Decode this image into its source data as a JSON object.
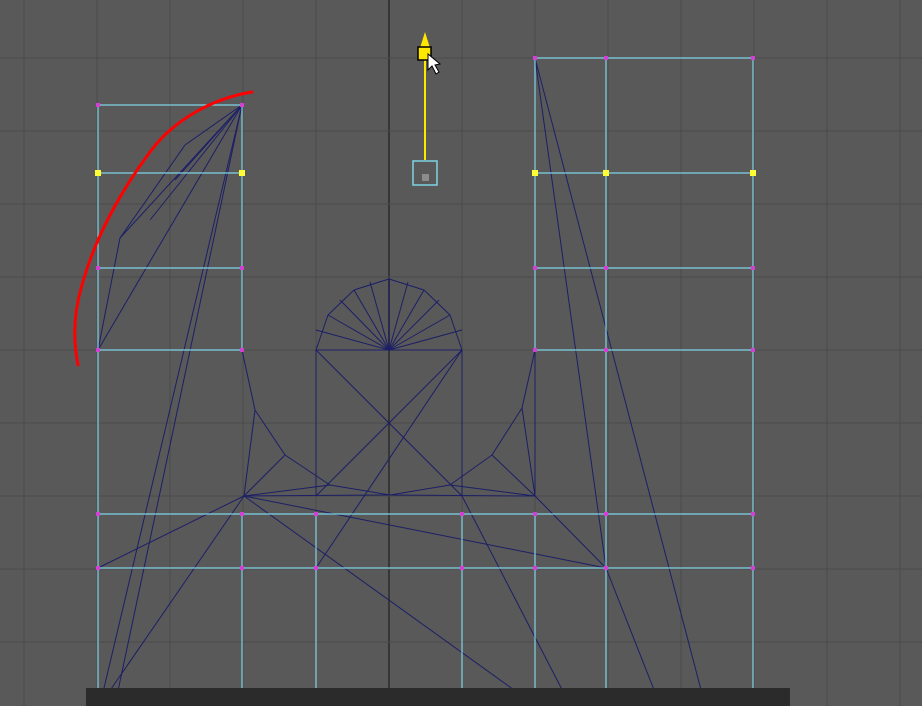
{
  "viewport": {
    "title": "",
    "colors": {
      "background": "#595959",
      "grid_line": "#4a4a4a",
      "grid_axis": "#363636",
      "wire_edge": "#1c1f66",
      "boundary_edge": "#7fd4e6",
      "vertex": "#d23fd2",
      "selected_vertex": "#ffff33",
      "annotation_stroke": "#ff0000",
      "manipulator": "#ffe800",
      "pivot": "#7fd4e6"
    },
    "icons": {
      "cursor": "arrow-cursor-icon",
      "manipulator": "move-manipulator-icon",
      "pivot": "pivot-icon"
    },
    "caption_text": ""
  }
}
